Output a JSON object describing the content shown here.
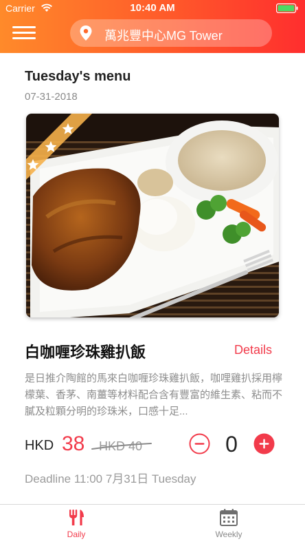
{
  "status_bar": {
    "carrier": "Carrier",
    "time": "10:40 AM"
  },
  "header": {
    "location": "萬兆豐中心MG Tower",
    "icons": [
      "menu-icon",
      "location-pin-icon"
    ]
  },
  "menu": {
    "title": "Tuesday's menu",
    "date": "07-31-2018"
  },
  "dish": {
    "name": "白咖喱珍珠雞扒飯",
    "details_label": "Details",
    "description": "是日推介陶館的馬來白咖喱珍珠雞扒飯，咖哩雞扒採用檸檬葉、香茅、南薑等材料配合含有豐富的維生素、粘而不膩及粒顆分明的珍珠米，口感十足...",
    "rating_stars": 3,
    "currency": "HKD",
    "price": "38",
    "original_price": "HKD 40",
    "quantity": "0",
    "deadline": "Deadline 11:00 7月31日 Tuesday"
  },
  "tabs": [
    {
      "label": "Daily",
      "icon": "fork-knife-icon",
      "active": true
    },
    {
      "label": "Weekly",
      "icon": "calendar-icon",
      "active": false
    }
  ],
  "colors": {
    "accent": "#f23b4b",
    "header_start": "#ff8a2a",
    "header_end": "#ff2e2e",
    "ribbon": "#f5b04a"
  }
}
